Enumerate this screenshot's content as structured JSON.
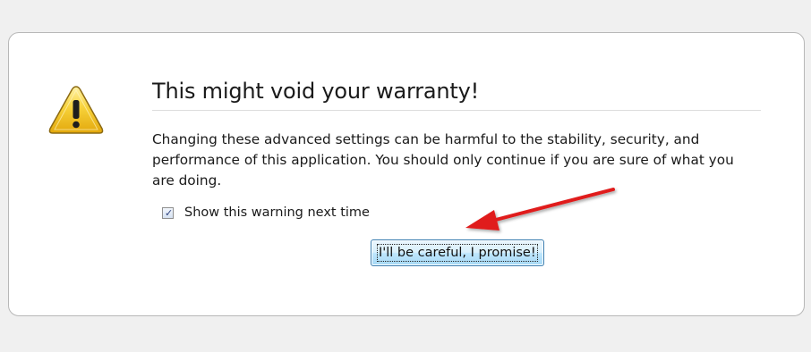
{
  "dialog": {
    "title": "This might void your warranty!",
    "message": "Changing these advanced settings can be harmful to the stability, security, and performance of this application. You should only continue if you are sure of what you are doing.",
    "checkbox": {
      "label": "Show this warning next time",
      "checked": true
    },
    "confirm_button_label": "I'll be careful, I promise!"
  },
  "icons": {
    "warning": "warning-triangle-icon",
    "annotation": "red-arrow-annotation"
  },
  "colors": {
    "page_background": "#f0f0f0",
    "panel_background": "#ffffff",
    "panel_border": "#b7b7b7",
    "warning_yellow": "#f7d23a",
    "button_border": "#3c7fb1",
    "annotation_red": "#e01a1a"
  }
}
